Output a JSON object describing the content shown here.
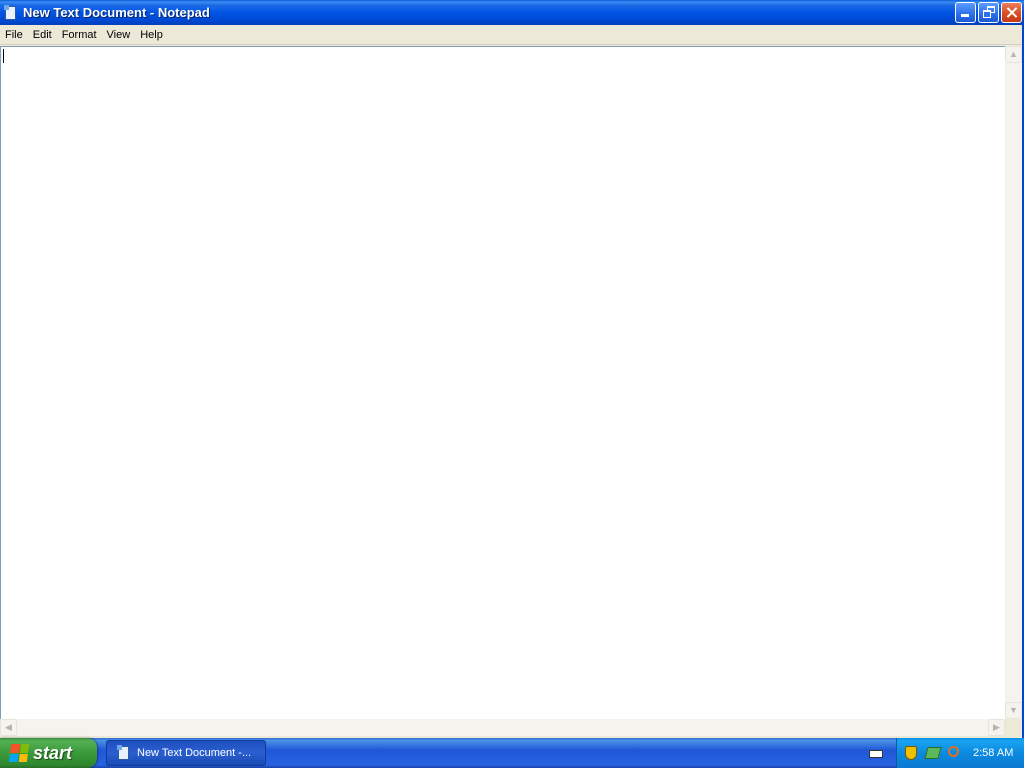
{
  "window": {
    "title": "New Text Document - Notepad",
    "app": "Notepad"
  },
  "menubar": {
    "items": [
      "File",
      "Edit",
      "Format",
      "View",
      "Help"
    ]
  },
  "editor": {
    "content": ""
  },
  "taskbar": {
    "start_label": "start",
    "tasks": [
      {
        "label": "New Text Document -..."
      }
    ],
    "clock": "2:58 AM"
  },
  "colors": {
    "titlebar": "#0055e5",
    "taskbar": "#2157d7",
    "start_button": "#3a9a3a",
    "tray": "#0b8ae0"
  },
  "icons": {
    "app": "notepad-icon",
    "tray": [
      "keyboard-icon",
      "security-shield-icon",
      "network-icon",
      "search-icon"
    ]
  }
}
